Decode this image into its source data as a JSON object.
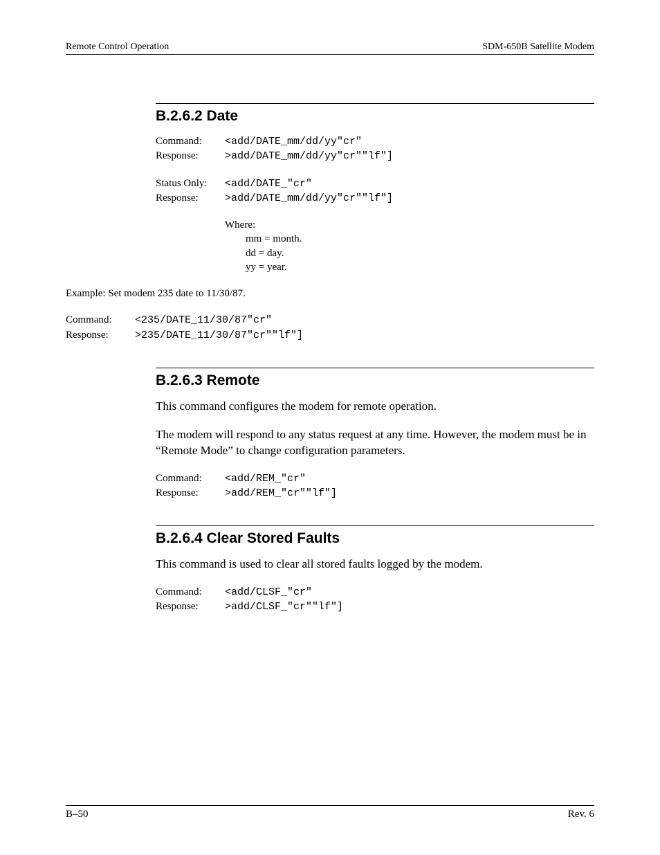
{
  "header": {
    "left": "Remote Control Operation",
    "right": "SDM-650B Satellite Modem"
  },
  "sections": {
    "date": {
      "heading": "B.2.6.2  Date",
      "block1": {
        "r1_label": "Command:",
        "r1_code": "<add/DATE_mm/dd/yy\"cr\"",
        "r2_label": "Response:",
        "r2_code": ">add/DATE_mm/dd/yy\"cr\"\"lf\"]"
      },
      "block2": {
        "r1_label": "Status Only:",
        "r1_code": "<add/DATE_\"cr\"",
        "r2_label": "Response:",
        "r2_code": ">add/DATE_mm/dd/yy\"cr\"\"lf\"]"
      },
      "where": {
        "title": "Where:",
        "l1": "mm = month.",
        "l2": "dd = day.",
        "l3": "yy = year."
      },
      "example": "Example: Set modem 235 date to 11/30/87.",
      "block3": {
        "r1_label": "Command:",
        "r1_code": "<235/DATE_11/30/87\"cr\"",
        "r2_label": "Response:",
        "r2_code": ">235/DATE_11/30/87\"cr\"\"lf\"]"
      }
    },
    "remote": {
      "heading": "B.2.6.3  Remote",
      "para1": "This command configures the modem for remote operation.",
      "para2": "The modem will respond to any status request at any time. However, the modem must be in “Remote Mode” to change configuration parameters.",
      "block": {
        "r1_label": "Command:",
        "r1_code": "<add/REM_\"cr\"",
        "r2_label": "Response:",
        "r2_code": ">add/REM_\"cr\"\"lf\"]"
      }
    },
    "clsf": {
      "heading": "B.2.6.4  Clear Stored Faults",
      "para1": "This command is used to clear all stored faults logged by the modem.",
      "block": {
        "r1_label": "Command:",
        "r1_code": "<add/CLSF_\"cr\"",
        "r2_label": "Response:",
        "r2_code": ">add/CLSF_\"cr\"\"lf\"]"
      }
    }
  },
  "footer": {
    "left": "B–50",
    "right": "Rev. 6"
  }
}
